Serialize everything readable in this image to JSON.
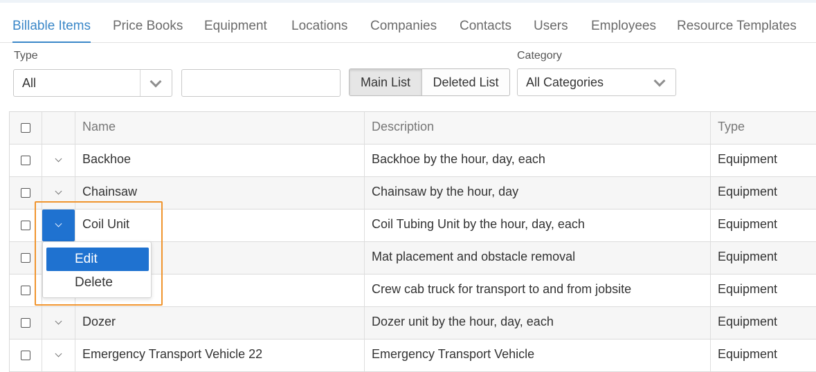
{
  "tabs": [
    {
      "label": "Billable Items",
      "active": true
    },
    {
      "label": "Price Books",
      "active": false
    },
    {
      "label": "Equipment",
      "active": false
    },
    {
      "label": "Locations",
      "active": false
    },
    {
      "label": "Companies",
      "active": false
    },
    {
      "label": "Contacts",
      "active": false
    },
    {
      "label": "Users",
      "active": false
    },
    {
      "label": "Employees",
      "active": false
    },
    {
      "label": "Resource Templates",
      "active": false
    }
  ],
  "filters": {
    "type_label": "Type",
    "type_value": "All",
    "search_value": "",
    "main_list_label": "Main List",
    "deleted_list_label": "Deleted List",
    "active_list": "Main List",
    "category_label": "Category",
    "category_value": "All Categories"
  },
  "table": {
    "columns": [
      "Name",
      "Description",
      "Type"
    ],
    "rows": [
      {
        "name": "Backhoe",
        "description": "Backhoe by the hour, day, each",
        "type": "Equipment"
      },
      {
        "name": "Chainsaw",
        "description": "Chainsaw by the hour, day",
        "type": "Equipment"
      },
      {
        "name": "Coil Unit",
        "description": "Coil Tubing Unit by the hour, day, each",
        "type": "Equipment"
      },
      {
        "name": "",
        "description": "Mat placement and obstacle removal",
        "type": "Equipment"
      },
      {
        "name": "",
        "description": "Crew cab truck for transport to and from jobsite",
        "type": "Equipment"
      },
      {
        "name": "Dozer",
        "description": "Dozer unit by the hour, day, each",
        "type": "Equipment"
      },
      {
        "name": "Emergency Transport Vehicle 22",
        "description": "Emergency Transport Vehicle",
        "type": "Equipment"
      }
    ]
  },
  "row_menu": {
    "edit_label": "Edit",
    "delete_label": "Delete",
    "highlighted": "Edit"
  },
  "colors": {
    "accent": "#3a87c8",
    "selected_button": "#1f72d0",
    "highlight_box": "#f0942d"
  }
}
